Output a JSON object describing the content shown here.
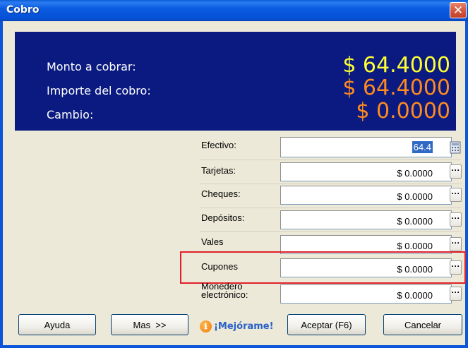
{
  "window": {
    "title": "Cobro",
    "close_label": "✕"
  },
  "summary": {
    "rows": [
      {
        "label": "Monto a cobrar:",
        "value": "$ 64.4000",
        "color": "#ffff33"
      },
      {
        "label": "Importe del cobro:",
        "value": "$ 64.4000",
        "color": "#ff8a1e"
      },
      {
        "label": "Cambio:",
        "value": "$ 0.0000",
        "color": "#ff8a1e"
      }
    ],
    "background": "#0a1a80"
  },
  "payments": {
    "efectivo": {
      "label": "Efectivo:",
      "value": "64.4",
      "icon": "calculator-icon"
    },
    "tarjetas": {
      "label": "Tarjetas:",
      "value": "$ 0.0000"
    },
    "cheques": {
      "label": "Cheques:",
      "value": "$ 0.0000"
    },
    "depositos": {
      "label": "Depósitos:",
      "value": "$ 0.0000"
    },
    "vales": {
      "label": "Vales",
      "value": "$ 0.0000"
    },
    "cupones": {
      "label": "Cupones",
      "value": "$ 0.0000"
    },
    "monedero": {
      "label_line1": "Monedero",
      "label_line2": "electrónico:",
      "value": "$ 0.0000"
    },
    "ellipsis_label": "···"
  },
  "buttons": {
    "ayuda": "Ayuda",
    "mas": "Mas  >>",
    "mejorame": "¡Mejórame!",
    "aceptar": "Aceptar (F6)",
    "cancelar": "Cancelar"
  },
  "highlight_color": "#e0202a"
}
